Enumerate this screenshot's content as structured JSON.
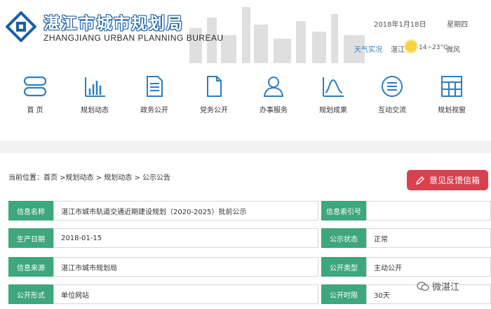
{
  "header": {
    "title_cn": "湛江市城市规划局",
    "title_en": "ZHANGJIANG URBAN PLANNING BUREAU",
    "date": "2018年1月18日",
    "weekday": "星期四",
    "weather_label": "天气实况",
    "weather_city": "湛江",
    "temperature": "14~23°C",
    "wind": "微风",
    "weather_icon": "sun-icon"
  },
  "nav": [
    {
      "label": "首 页",
      "icon": "home-icon"
    },
    {
      "label": "规划动态",
      "icon": "bar-chart-icon"
    },
    {
      "label": "政务公开",
      "icon": "document-icon"
    },
    {
      "label": "党务公开",
      "icon": "file-icon"
    },
    {
      "label": "办事服务",
      "icon": "user-icon"
    },
    {
      "label": "规划成果",
      "icon": "wave-chart-icon"
    },
    {
      "label": "互动交流",
      "icon": "chat-list-icon"
    },
    {
      "label": "规划视窗",
      "icon": "grid-window-icon"
    }
  ],
  "breadcrumb": "当前位置：首页 >规划动态 > 规划动态 > 公示公告",
  "feedback_label": "意见反馈信箱",
  "info_rows": [
    {
      "label1": "信息名称",
      "value1": "湛江市城市轨道交通近期建设规划（2020-2025）批前公示",
      "label2": "信息索引号",
      "value2": ""
    },
    {
      "label1": "生产日期",
      "value1": "2018-01-15",
      "label2": "公示状态",
      "value2": "正常"
    },
    {
      "label1": "信息来源",
      "value1": "湛江市城市规划局",
      "label2": "公开类型",
      "value2": "主动公开"
    },
    {
      "label1": "公开形式",
      "value1": "单位网站",
      "label2": "公开时限",
      "value2": "30天"
    }
  ],
  "watermark": "微湛江",
  "colors": {
    "accent_green": "#3ea77b",
    "feedback_red": "#d9414e",
    "nav_blue": "#2a7fc3"
  }
}
